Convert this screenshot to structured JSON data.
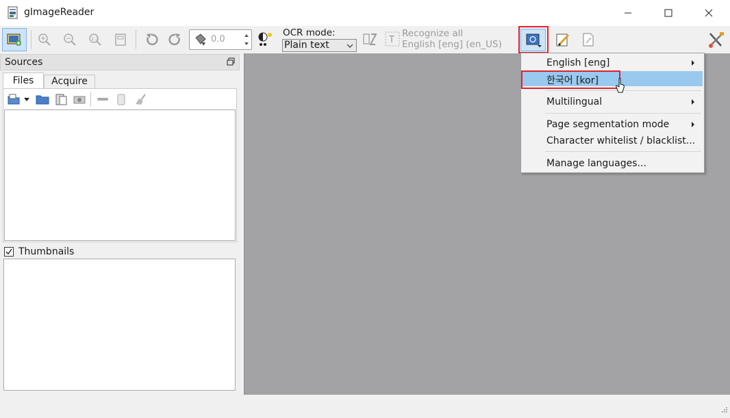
{
  "window": {
    "title": "gImageReader",
    "controls": [
      "minimize",
      "maximize",
      "close"
    ]
  },
  "toolbar": {
    "rotation_value": "0.0",
    "ocr_mode_label": "OCR mode:",
    "ocr_mode_value": "Plain text",
    "recognize_line1": "Recognize all",
    "recognize_line2": "English [eng] (en_US)"
  },
  "sources": {
    "title": "Sources",
    "tabs": [
      {
        "label": "Files",
        "active": true
      },
      {
        "label": "Acquire",
        "active": false
      }
    ],
    "thumbnails_label": "Thumbnails",
    "thumbnails_checked": true
  },
  "language_menu": {
    "items": [
      {
        "label": "English [eng]",
        "submenu": true,
        "selected": false
      },
      {
        "label": "한국어 [kor]",
        "submenu": false,
        "selected": true
      },
      {
        "label": "Multilingual",
        "submenu": true,
        "selected": false
      },
      {
        "label": "Page segmentation mode",
        "submenu": true,
        "selected": false
      },
      {
        "label": "Character whitelist / blacklist...",
        "submenu": false,
        "selected": false
      },
      {
        "label": "Manage languages...",
        "submenu": false,
        "selected": false
      }
    ]
  },
  "colors": {
    "highlight": "#e32028",
    "menu_selection": "#99c9ef",
    "canvas": "#a3a3a6"
  }
}
